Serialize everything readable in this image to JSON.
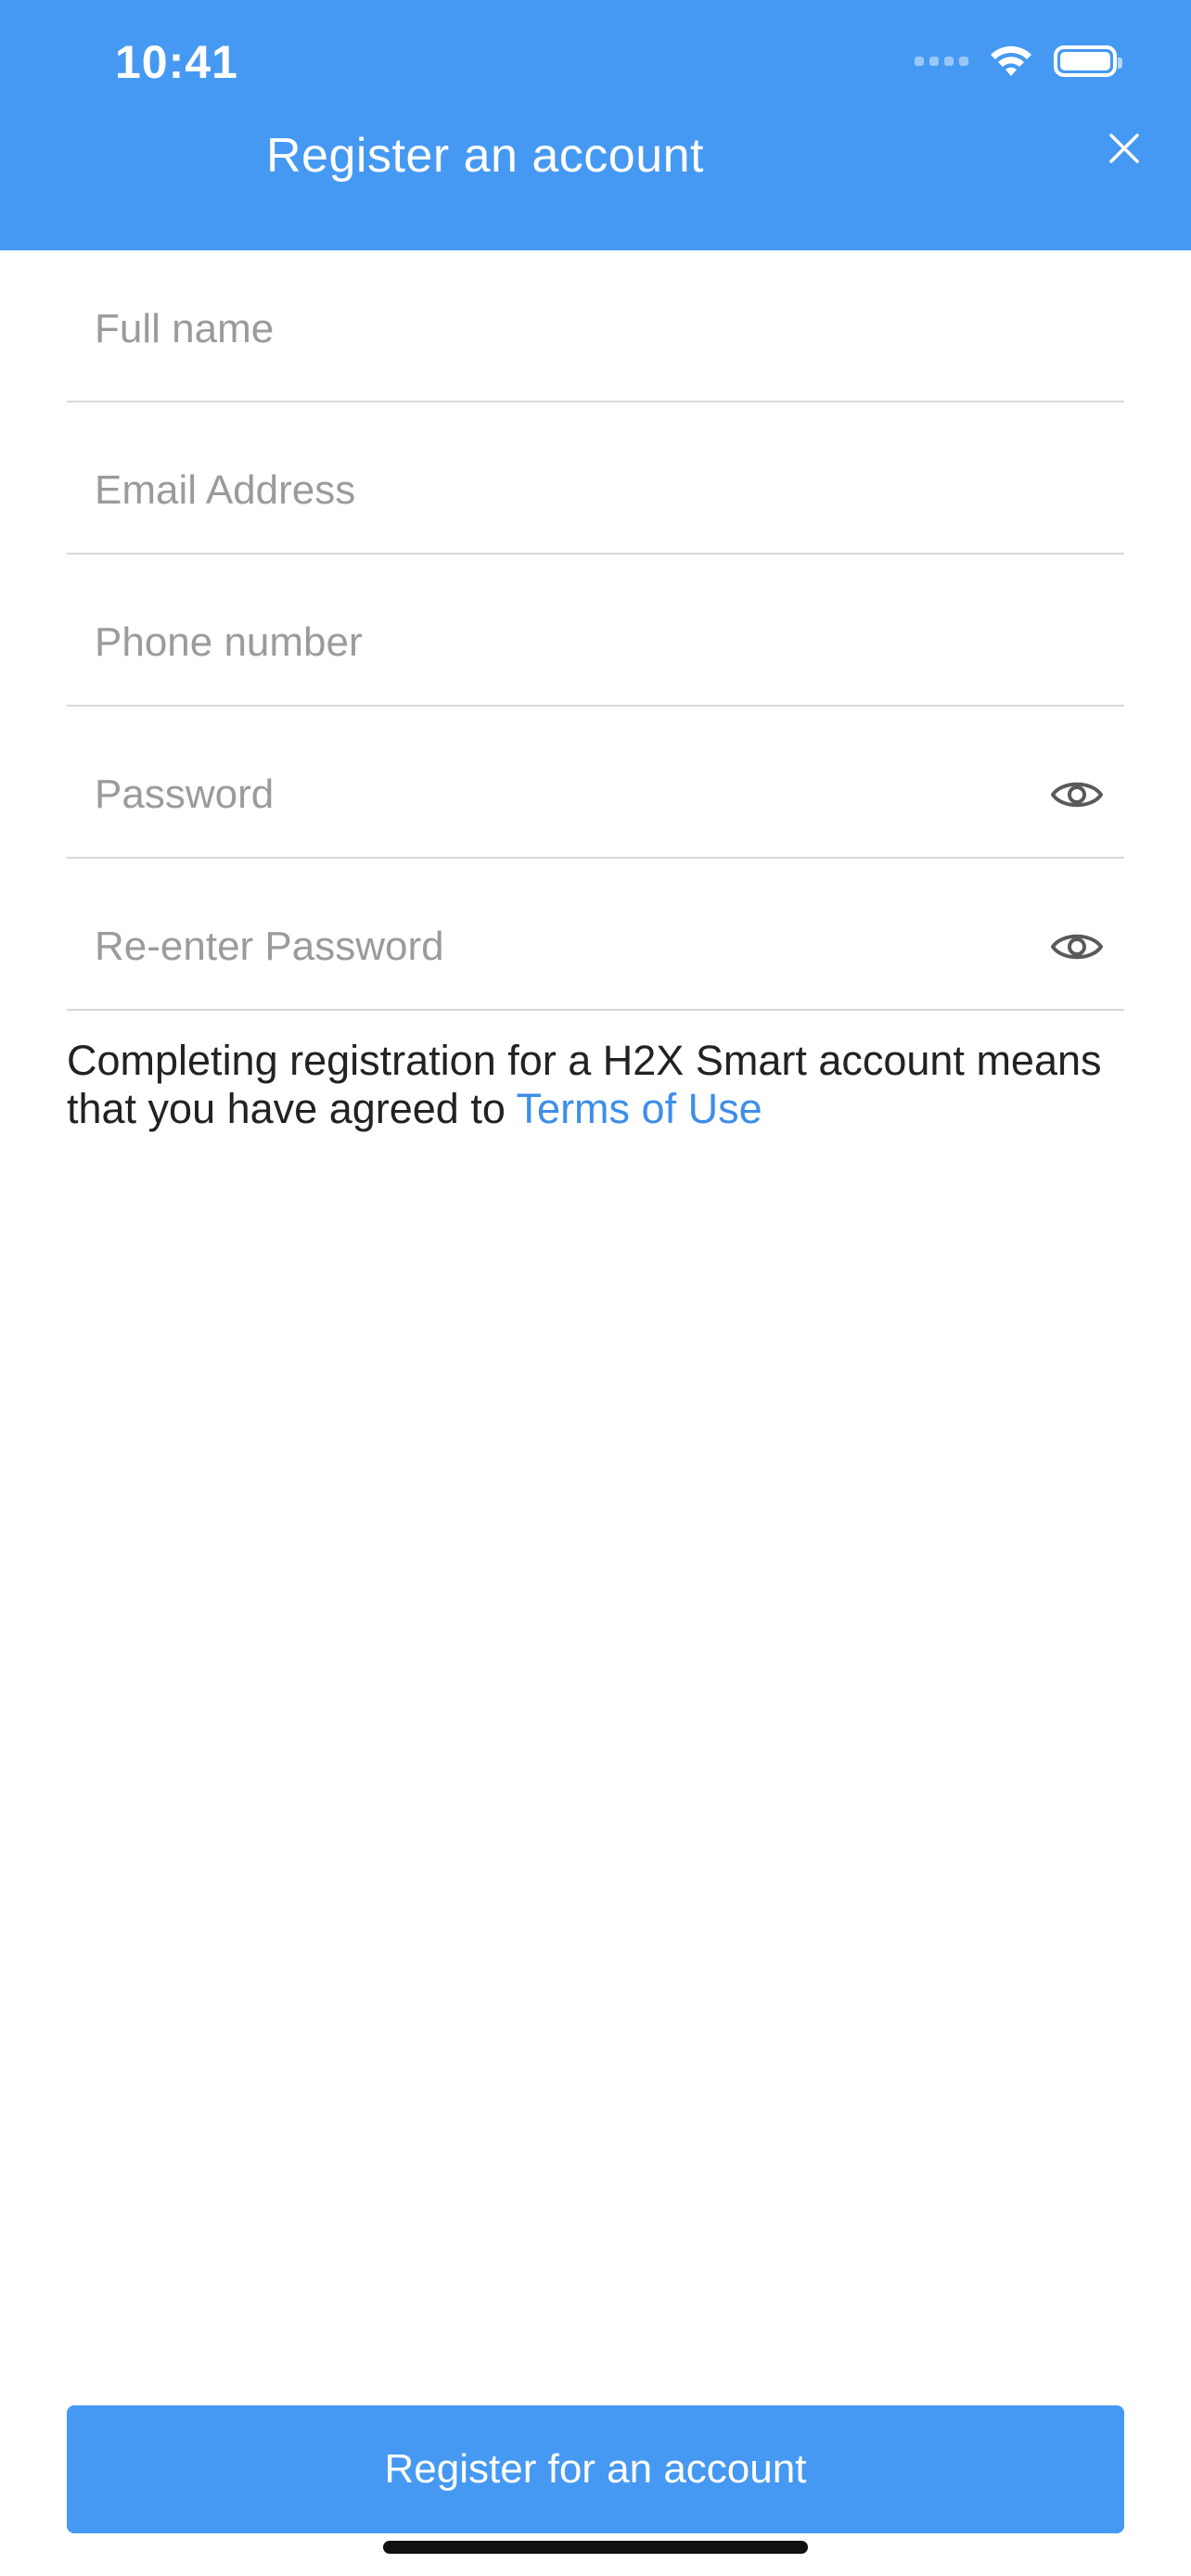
{
  "status_bar": {
    "time": "10:41",
    "icons": [
      "cellular-signal-icon",
      "wifi-icon",
      "battery-icon"
    ]
  },
  "header": {
    "title": "Register an account",
    "close_icon": "close-icon"
  },
  "form": {
    "full_name": {
      "placeholder": "Full name",
      "value": ""
    },
    "email": {
      "placeholder": "Email Address",
      "value": ""
    },
    "phone": {
      "placeholder": "Phone number",
      "value": ""
    },
    "password": {
      "placeholder": "Password",
      "value": "",
      "toggle_icon": "eye-icon"
    },
    "confirm_password": {
      "placeholder": "Re-enter Password",
      "value": "",
      "toggle_icon": "eye-icon"
    }
  },
  "terms": {
    "text": "Completing registration for a H2X Smart account means that you have agreed to ",
    "link_label": "Terms of Use"
  },
  "actions": {
    "register_label": "Register for an account"
  },
  "colors": {
    "primary": "#4699F2",
    "link": "#3D8EEB",
    "placeholder": "#9b9b9b",
    "divider": "#d8d8d8"
  }
}
